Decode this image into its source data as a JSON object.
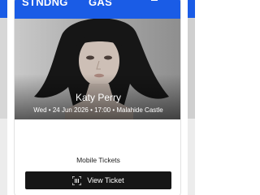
{
  "header": {
    "brand_left": "STNDNG",
    "brand_mid": "GAS",
    "icon": "menu-icon"
  },
  "event": {
    "artist": "Katy Perry",
    "details": "Wed • 24 Jun 2026 • 17:00 • Malahide Castle"
  },
  "tickets": {
    "label": "Mobile Tickets",
    "button_label": "View Ticket",
    "button_icon": "qr-code-icon"
  },
  "colors": {
    "brand_blue": "#1a5ce6",
    "button_bg": "#161616"
  }
}
